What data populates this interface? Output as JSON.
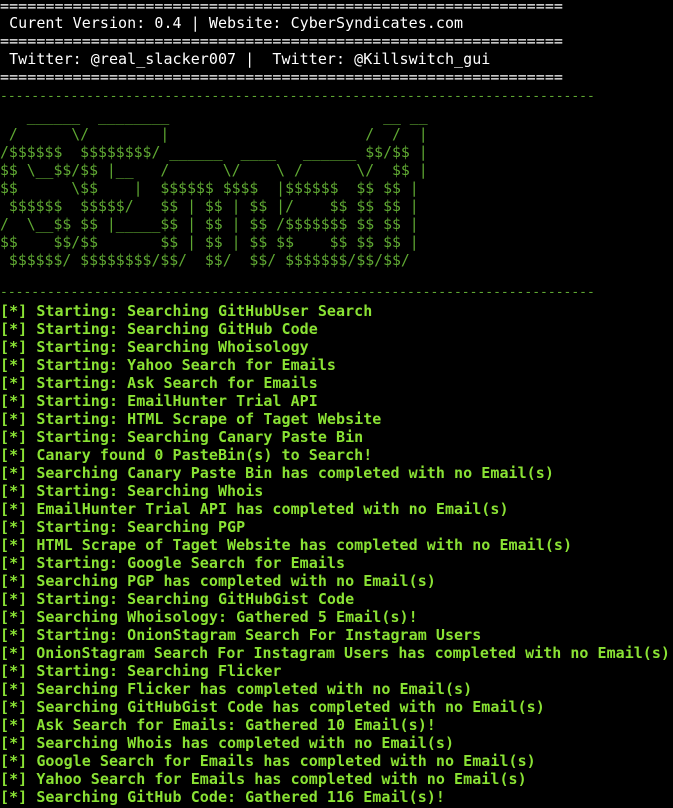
{
  "header": {
    "rule": "==============================================================",
    "version_line": " Curent Version: 0.4 | Website: CyberSyndicates.com",
    "twitter_line": " Twitter: @real_slacker007 |  Twitter: @Killswitch_gui"
  },
  "separator": "----------------------------------------------------------------------------",
  "banner": [
    "   ______  ________                        __ __",
    " /      \\/        |                      /  /  |",
    "/$$$$$$  $$$$$$$$/ ______  ____   ______ $$/$$ |",
    "$$ \\__$$/$$ |__   /      \\/    \\ /      \\/  $$ |",
    "$$      \\$$    |  $$$$$$ $$$$  |$$$$$$  $$ $$ |",
    " $$$$$$  $$$$$/   $$ | $$ | $$ |/    $$ $$ $$ |",
    "/  \\__$$ $$ |_____$$ | $$ | $$ /$$$$$$$ $$ $$ |",
    "$$    $$/$$       $$ | $$ | $$ $$    $$ $$ $$ |",
    " $$$$$$/ $$$$$$$$/$$/  $$/  $$/ $$$$$$$/$$/$$/"
  ],
  "log": [
    "[*] Starting: Searching GitHubUser Search",
    "[*] Starting: Searching GitHub Code",
    "[*] Starting: Searching Whoisology",
    "[*] Starting: Yahoo Search for Emails",
    "[*] Starting: Ask Search for Emails",
    "[*] Starting: EmailHunter Trial API",
    "[*] Starting: HTML Scrape of Taget Website",
    "[*] Starting: Searching Canary Paste Bin",
    "[*] Canary found 0 PasteBin(s) to Search!",
    "[*] Searching Canary Paste Bin has completed with no Email(s)",
    "[*] Starting: Searching Whois",
    "[*] EmailHunter Trial API has completed with no Email(s)",
    "[*] Starting: Searching PGP",
    "[*] HTML Scrape of Taget Website has completed with no Email(s)",
    "[*] Starting: Google Search for Emails",
    "[*] Searching PGP has completed with no Email(s)",
    "[*] Starting: Searching GitHubGist Code",
    "[*] Searching Whoisology: Gathered 5 Email(s)!",
    "[*] Starting: OnionStagram Search For Instagram Users",
    "[*] OnionStagram Search For Instagram Users has completed with no Email(s)",
    "[*] Starting: Searching Flicker",
    "[*] Searching Flicker has completed with no Email(s)",
    "[*] Searching GitHubGist Code has completed with no Email(s)",
    "[*] Ask Search for Emails: Gathered 10 Email(s)!",
    "[*] Searching Whois has completed with no Email(s)",
    "[*] Google Search for Emails has completed with no Email(s)",
    "[*] Yahoo Search for Emails has completed with no Email(s)",
    "[*] Searching GitHub Code: Gathered 116 Email(s)!"
  ],
  "colors": {
    "background": "#000000",
    "header_text": "#ffffff",
    "banner": "#5fa832",
    "log_text": "#8ae234"
  }
}
